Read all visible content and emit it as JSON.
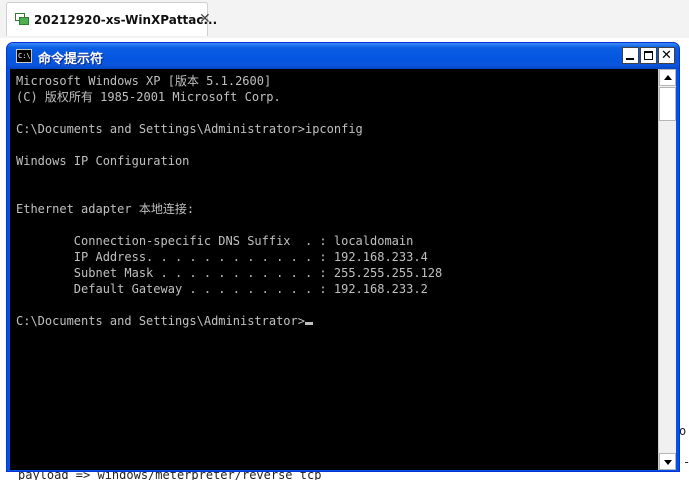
{
  "vm_tab": {
    "title": "20212920-xs-WinXPattac...",
    "close_glyph": "✕",
    "icon": "vm-icon"
  },
  "background": {
    "bottom_text": "payload => windows/meterpreter/reverse_tcp",
    "right_char": "o",
    "right_char2": "-"
  },
  "window": {
    "title": "命令提示符",
    "icon_label": "C:\\",
    "icon": "console-icon",
    "buttons": {
      "minimize": "minimize",
      "maximize": "maximize",
      "close": "✕"
    }
  },
  "console": {
    "lines": [
      "Microsoft Windows XP [版本 5.1.2600]",
      "(C) 版权所有 1985-2001 Microsoft Corp.",
      "",
      "C:\\Documents and Settings\\Administrator>ipconfig",
      "",
      "Windows IP Configuration",
      "",
      "",
      "Ethernet adapter 本地连接:",
      "",
      "        Connection-specific DNS Suffix  . : localdomain",
      "        IP Address. . . . . . . . . . . . : 192.168.233.4",
      "        Subnet Mask . . . . . . . . . . . : 255.255.255.128",
      "        Default Gateway . . . . . . . . . : 192.168.233.2",
      "",
      "C:\\Documents and Settings\\Administrator>"
    ]
  },
  "colors": {
    "titlebar": "#0555e0",
    "console_bg": "#000000",
    "console_fg": "#c0c0c0"
  }
}
